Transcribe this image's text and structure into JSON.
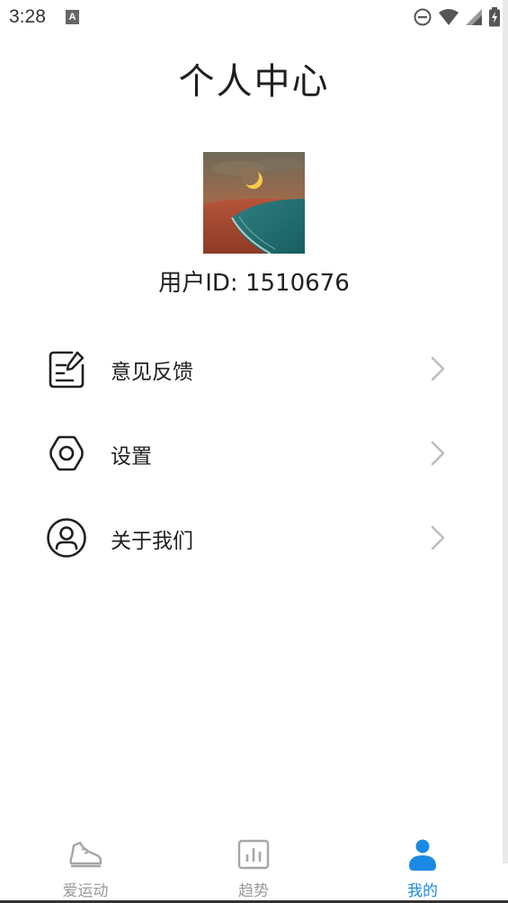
{
  "status_bar": {
    "time": "3:28",
    "notification_icon_letter": "A",
    "icons": [
      "do-not-disturb-icon",
      "wifi-icon",
      "cellular-signal-icon",
      "battery-charging-icon"
    ]
  },
  "page": {
    "title": "个人中心"
  },
  "profile": {
    "user_id_label": "用户ID: 1510676"
  },
  "menu": {
    "items": [
      {
        "label": "意见反馈",
        "icon": "feedback-edit-icon"
      },
      {
        "label": "设置",
        "icon": "settings-gear-icon"
      },
      {
        "label": "关于我们",
        "icon": "about-user-icon"
      }
    ]
  },
  "bottom_nav": {
    "items": [
      {
        "label": "爱运动",
        "icon": "sneaker-icon",
        "active": false
      },
      {
        "label": "趋势",
        "icon": "trend-chart-icon",
        "active": false
      },
      {
        "label": "我的",
        "icon": "profile-person-icon",
        "active": true
      }
    ]
  },
  "colors": {
    "accent": "#1a8ae5",
    "inactive": "#9a9a9a",
    "text": "#1f1f1f",
    "chevron": "#bdbdbd"
  }
}
